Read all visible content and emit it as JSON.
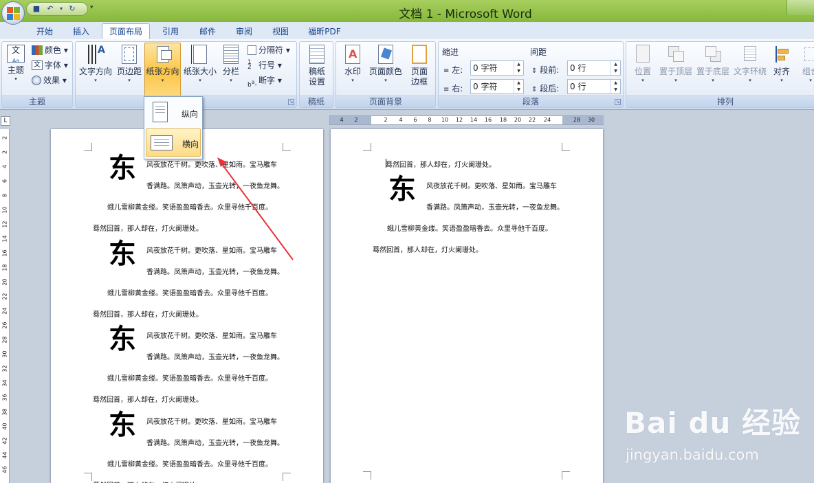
{
  "window": {
    "title": "文档 1 - Microsoft Word"
  },
  "tabs": [
    "开始",
    "插入",
    "页面布局",
    "引用",
    "邮件",
    "审阅",
    "视图",
    "福昕PDF"
  ],
  "active_tab": "页面布局",
  "ribbon": {
    "theme_group": {
      "label": "主题",
      "theme_btn": "主题",
      "colors": "颜色",
      "fonts": "字体",
      "effects": "效果"
    },
    "page_setup_group": {
      "label": "页面设置",
      "text_direction": "文字方向",
      "margins": "页边距",
      "orientation": "纸张方向",
      "size": "纸张大小",
      "columns": "分栏",
      "breaks": "分隔符",
      "line_numbers": "行号",
      "hyphenation": "断字"
    },
    "paper_group": {
      "label": "稿纸",
      "btn_line1": "稿纸",
      "btn_line2": "设置"
    },
    "page_bg_group": {
      "label": "页面背景",
      "watermark": "水印",
      "page_color": "页面颜色",
      "borders_line1": "页面",
      "borders_line2": "边框"
    },
    "paragraph_group": {
      "label": "段落",
      "indent_title": "缩进",
      "spacing_title": "间距",
      "left_label": "左:",
      "left_value": "0 字符",
      "right_label": "右:",
      "right_value": "0 字符",
      "before_label": "段前:",
      "before_value": "0 行",
      "after_label": "段后:",
      "after_value": "0 行"
    },
    "arrange_group": {
      "label": "排列",
      "position": "位置",
      "bring_front": "置于顶层",
      "send_back": "置于底层",
      "text_wrap": "文字环绕",
      "align": "对齐",
      "group": "组合"
    }
  },
  "orientation_menu": {
    "portrait": "纵向",
    "landscape": "横向"
  },
  "ruler": {
    "horizontal_ticks": [
      "4",
      "2",
      "2",
      "4",
      "6",
      "8",
      "10",
      "12",
      "14",
      "16",
      "18",
      "20",
      "22",
      "24",
      "28",
      "30"
    ],
    "vertical_ticks": [
      "2",
      "2",
      "4",
      "6",
      "8",
      "10",
      "12",
      "14",
      "16",
      "18",
      "20",
      "22",
      "24",
      "26",
      "28",
      "30",
      "32",
      "34",
      "36",
      "38",
      "40",
      "42",
      "44",
      "46"
    ]
  },
  "document": {
    "dropcap": "东",
    "line1": "风夜放花千树。更吹落、星如雨。宝马雕车",
    "line2": "香满路。凤箫声动，玉壶光转，一夜鱼龙舞。",
    "line3": "蛾儿雪柳黄金缕。笑语盈盈暗香去。众里寻他千百度。",
    "line4": "蓦然回首，那人却在，灯火阑珊处。"
  },
  "watermark": {
    "logo": "Bai du 经验",
    "url": "jingyan.baidu.com"
  }
}
